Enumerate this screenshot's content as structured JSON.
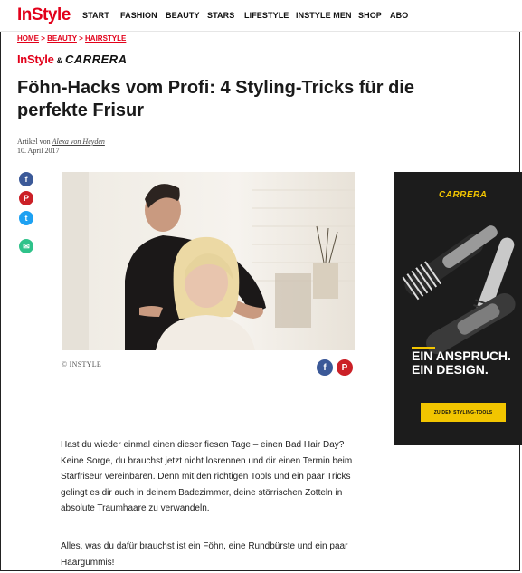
{
  "nav": {
    "logo": "InStyle",
    "items": [
      "START",
      "FASHION",
      "BEAUTY",
      "STARS",
      "LIFESTYLE",
      "INSTYLE MEN",
      "SHOP",
      "ABO"
    ]
  },
  "breadcrumb": [
    "HOME",
    "BEAUTY",
    "HAIRSTYLE"
  ],
  "sponsor": {
    "instyle": "InStyle",
    "amp": "&",
    "partner": "CARRERA"
  },
  "article": {
    "title": "Föhn-Hacks vom Profi: 4 Styling-Tricks für die perfekte Frisur",
    "byline_prefix": "Artikel von",
    "author": "Alexa von Heyden",
    "date": "10. April 2017",
    "image_credit": "© INSTYLE",
    "paragraphs": [
      "Hast du wieder einmal einen dieser fiesen Tage – einen Bad Hair Day? Keine Sorge, du brauchst jetzt nicht losrennen und dir einen Termin beim Starfriseur vereinbaren. Denn mit den richtigen Tools und ein paar Tricks gelingt es dir auch in deinem Badezimmer, deine störrischen Zotteln in absolute Traumhaare zu verwandeln.",
      "Alles, was du dafür brauchst ist ein Föhn, eine Rundbürste und ein paar Haargummis!"
    ]
  },
  "share": [
    {
      "icon": "facebook-icon",
      "glyph": "f",
      "color": "#3b5998"
    },
    {
      "icon": "pinterest-icon",
      "glyph": "P",
      "color": "#cb2027"
    },
    {
      "icon": "twitter-icon",
      "glyph": "t",
      "color": "#1da1f2"
    },
    {
      "icon": "email-icon",
      "glyph": "✉",
      "color": "#2fc28a"
    }
  ],
  "ad": {
    "brand": "CARRERA",
    "headline_1": "EIN ANSPRUCH.",
    "headline_2": "EIN DESIGN.",
    "cta": "ZU DEN STYLING-TOOLS"
  },
  "colors": {
    "brand_red": "#e2001a",
    "ad_yellow": "#f2c500"
  }
}
